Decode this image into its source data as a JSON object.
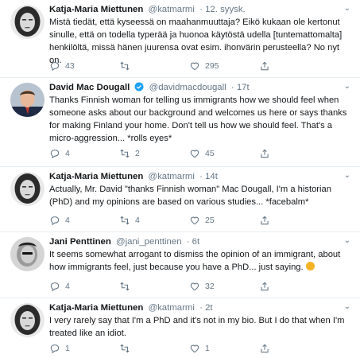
{
  "tweets": [
    {
      "name": "Katja-Maria Miettunen",
      "handle": "@katmarmi",
      "time": "· 12. syysk.",
      "verified": false,
      "text": "Mistä tiedät, että kyseessä on maahanmuuttaja? Eikö kukaan ole kertonut sinulle, että on todella typerää ja huonoa käytöstä udella [tuntemattomalta] henkilöltä, missä hänen juurensa ovat esim. ihonvärin perusteella? No nyt on.",
      "replies": "43",
      "retweets": "",
      "likes": "295"
    },
    {
      "name": "David Mac Dougall",
      "handle": "@davidmacdougall",
      "time": "· 17t",
      "verified": true,
      "text": "Thanks Finnish woman for telling us immigrants how we should feel when someone asks about our background and welcomes us here or says thanks for making Finland your home. Don't tell us how we should feel. That's a micro-aggression... *rolls eyes*",
      "replies": "4",
      "retweets": "2",
      "likes": "45"
    },
    {
      "name": "Katja-Maria Miettunen",
      "handle": "@katmarmi",
      "time": "· 14t",
      "verified": false,
      "text": "Actually, Mr. David \"thanks Finnish woman\" Mac Dougall, I'm a historian (PhD) and my opinions are based on various studies... *facebalm*",
      "replies": "4",
      "retweets": "4",
      "likes": "25"
    },
    {
      "name": "Jani Penttinen",
      "handle": "@jani_penttinen",
      "time": "· 6t",
      "verified": false,
      "text": "It seems somewhat arrogant to dismiss the opinion of an immigrant, about how immigrants feel, just because you have a PhD... just saying.",
      "replies": "4",
      "retweets": "",
      "likes": "32"
    },
    {
      "name": "Katja-Maria Miettunen",
      "handle": "@katmarmi",
      "time": "· 2t",
      "verified": false,
      "text": "I very rarely say that I'm a PhD and it's not in my bio. But I do that when I'm treated like an idiot.",
      "replies": "1",
      "retweets": "",
      "likes": "1"
    }
  ],
  "colors": {
    "text": "#14171a",
    "muted": "#657786",
    "verified": "#1da1f2",
    "divider": "#e6ecf0"
  }
}
